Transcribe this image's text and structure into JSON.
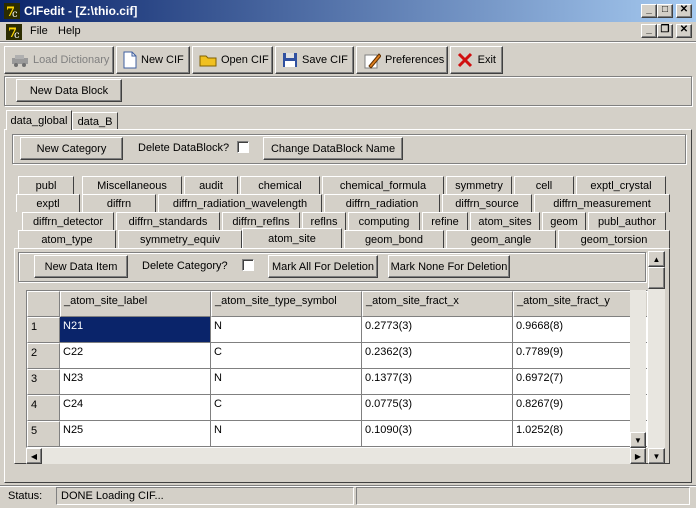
{
  "window": {
    "title": "CIFedit - [Z:\\thio.cif]"
  },
  "menu": {
    "file": "File",
    "help": "Help"
  },
  "toolbar": {
    "load_dictionary": "Load Dictionary",
    "new_cif": "New CIF",
    "open_cif": "Open CIF",
    "save_cif": "Save CIF",
    "preferences": "Preferences",
    "exit": "Exit"
  },
  "new_data_block": "New Data Block",
  "data_tabs": [
    "data_global",
    "data_B"
  ],
  "block_controls": {
    "new_category": "New Category",
    "delete_datablock": "Delete DataBlock?",
    "change_name": "Change DataBlock Name"
  },
  "category_rows": [
    [
      "publ",
      "Miscellaneous",
      "audit",
      "chemical",
      "chemical_formula",
      "symmetry",
      "cell",
      "exptl_crystal"
    ],
    [
      "exptl",
      "diffrn",
      "diffrn_radiation_wavelength",
      "diffrn_radiation",
      "diffrn_source",
      "diffrn_measurement"
    ],
    [
      "diffrn_detector",
      "diffrn_standards",
      "diffrn_reflns",
      "reflns",
      "computing",
      "refine",
      "atom_sites",
      "geom",
      "publ_author"
    ],
    [
      "atom_type",
      "symmetry_equiv",
      "atom_site",
      "geom_bond",
      "geom_angle",
      "geom_torsion"
    ]
  ],
  "category_controls": {
    "new_data_item": "New Data Item",
    "delete_category": "Delete Category?",
    "mark_all": "Mark All For Deletion",
    "mark_none": "Mark None For Deletion"
  },
  "table": {
    "columns": [
      "_atom_site_label",
      "_atom_site_type_symbol",
      "_atom_site_fract_x",
      "_atom_site_fract_y"
    ],
    "rows": [
      [
        "1",
        "N21",
        "N",
        "0.2773(3)",
        "0.9668(8)"
      ],
      [
        "2",
        "C22",
        "C",
        "0.2362(3)",
        "0.7789(9)"
      ],
      [
        "3",
        "N23",
        "N",
        "0.1377(3)",
        "0.6972(7)"
      ],
      [
        "4",
        "C24",
        "C",
        "0.0775(3)",
        "0.8267(9)"
      ],
      [
        "5",
        "N25",
        "N",
        "0.1090(3)",
        "1.0252(8)"
      ]
    ]
  },
  "status": {
    "label": "Status:",
    "text": "DONE Loading CIF..."
  }
}
